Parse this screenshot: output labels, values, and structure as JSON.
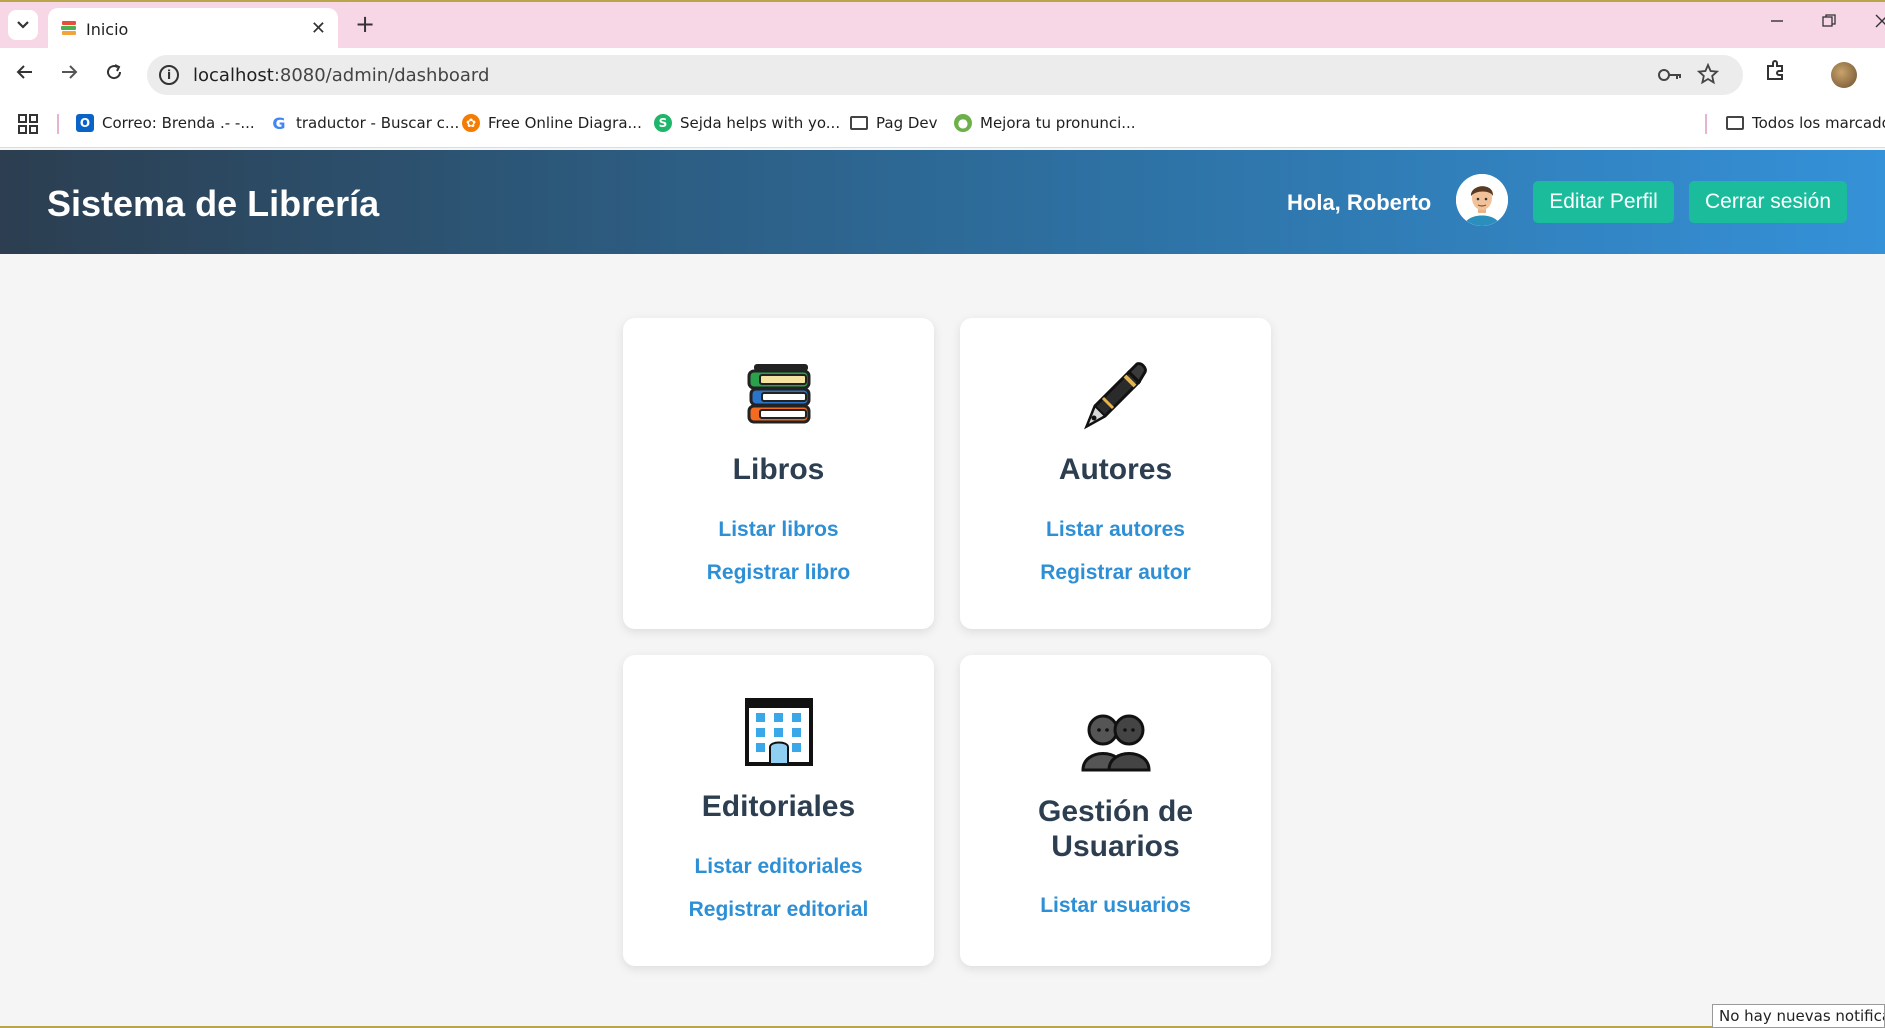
{
  "browser": {
    "tab_title": "Inicio",
    "tab_close": "✕",
    "new_tab": "+",
    "url_host": "localhost",
    "url_rest": ":8080/admin/dashboard",
    "bookmarks": [
      {
        "label": "Correo: Brenda .- -...",
        "icon": "outlook-icon",
        "color": "#0a64c8"
      },
      {
        "label": "traductor - Buscar c...",
        "icon": "google-icon",
        "color": "#4285f4"
      },
      {
        "label": "Free Online Diagra...",
        "icon": "diagram-icon",
        "color": "#f57c00"
      },
      {
        "label": "Sejda helps with yo...",
        "icon": "sejda-icon",
        "color": "#1fb56a"
      },
      {
        "label": "Pag Dev",
        "icon": "folder-icon"
      },
      {
        "label": "Mejora tu pronunci...",
        "icon": "speech-icon",
        "color": "#6bb04a"
      }
    ],
    "all_bookmarks": "Todos los marcadores"
  },
  "header": {
    "brand": "Sistema de Librería",
    "greeting": "Hola, Roberto",
    "edit_profile": "Editar Perfil",
    "logout": "Cerrar sesión"
  },
  "cards": [
    {
      "title": "Libros",
      "icon": "books-icon",
      "links": [
        "Listar libros",
        "Registrar libro"
      ]
    },
    {
      "title": "Autores",
      "icon": "pen-icon",
      "links": [
        "Listar autores",
        "Registrar autor"
      ]
    },
    {
      "title": "Editoriales",
      "icon": "office-building-icon",
      "links": [
        "Listar editoriales",
        "Registrar editorial"
      ]
    },
    {
      "title_line1": "Gestión de",
      "title_line2": "Usuarios",
      "icon": "users-icon",
      "links": [
        "Listar usuarios"
      ]
    }
  ],
  "status": {
    "notification": "No hay nuevas notificaciones"
  },
  "colors": {
    "accent_button": "#1abc9c",
    "link": "#2d8fd5",
    "title": "#2c3e50",
    "header_gradient_start": "#2c3e50",
    "header_gradient_end": "#3591d8"
  }
}
